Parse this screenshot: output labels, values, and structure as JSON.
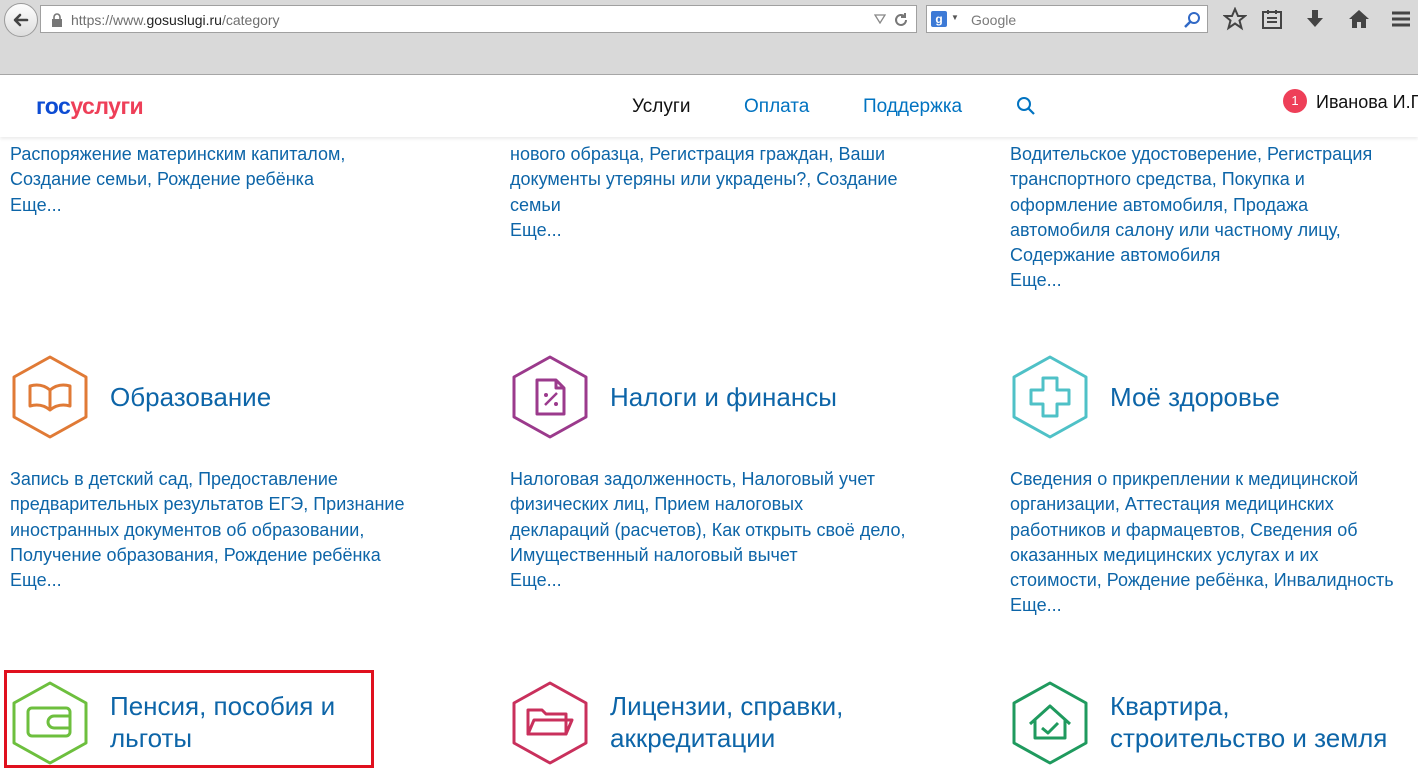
{
  "browser": {
    "url_prefix": "https://www.",
    "url_domain": "gosuslugi.ru",
    "url_path": "/category",
    "search_placeholder": "Google",
    "search_engine_letter": "g"
  },
  "header": {
    "logo_part1": "гос",
    "logo_part2": "услуги",
    "nav": [
      "Услуги",
      "Оплата",
      "Поддержка"
    ],
    "notifications_count": "1",
    "user_name": "Иванова И.Г."
  },
  "more_label": "Еще...",
  "top_row": [
    {
      "links": [
        "Распоряжение материнским капиталом,",
        "Создание семьи, Рождение ребёнка"
      ]
    },
    {
      "links": [
        "нового образца, Регистрация граждан, Ваши",
        "документы утеряны или украдены?, Создание",
        "семьи"
      ]
    },
    {
      "links": [
        "Водительское удостоверение, Регистрация",
        "транспортного средства, Покупка и",
        "оформление автомобиля, Продажа",
        "автомобиля салону или частному лицу,",
        "Содержание автомобиля"
      ]
    }
  ],
  "categories": [
    {
      "title": "Образование",
      "icon": "book-icon",
      "color": "#e07a36",
      "links": [
        "Запись в детский сад, Предоставление",
        "предварительных результатов ЕГЭ, Признание",
        "иностранных документов об образовании,",
        "Получение образования, Рождение ребёнка"
      ]
    },
    {
      "title": "Налоги и финансы",
      "icon": "tax-document-icon",
      "color": "#9b3a8c",
      "links": [
        "Налоговая задолженность, Налоговый учет",
        "физических лиц, Прием налоговых",
        "деклараций (расчетов), Как открыть своё дело,",
        "Имущественный налоговый вычет"
      ]
    },
    {
      "title": "Моё здоровье",
      "icon": "medical-cross-icon",
      "color": "#4fc1c7",
      "links": [
        "Сведения о прикреплении к медицинской",
        "организации, Аттестация медицинских",
        "работников и фармацевтов, Сведения об",
        "оказанных медицинских услугах и их",
        "стоимости, Рождение ребёнка, Инвалидность"
      ]
    },
    {
      "title_lines": [
        "Пенсия, пособия и",
        "льготы"
      ],
      "icon": "wallet-icon",
      "color": "#6dbf3e"
    },
    {
      "title_lines": [
        "Лицензии, справки,",
        "аккредитации"
      ],
      "icon": "folder-icon",
      "color": "#c9305c"
    },
    {
      "title_lines": [
        "Квартира,",
        "строительство и земля"
      ],
      "icon": "house-icon",
      "color": "#1f9a5e"
    }
  ]
}
